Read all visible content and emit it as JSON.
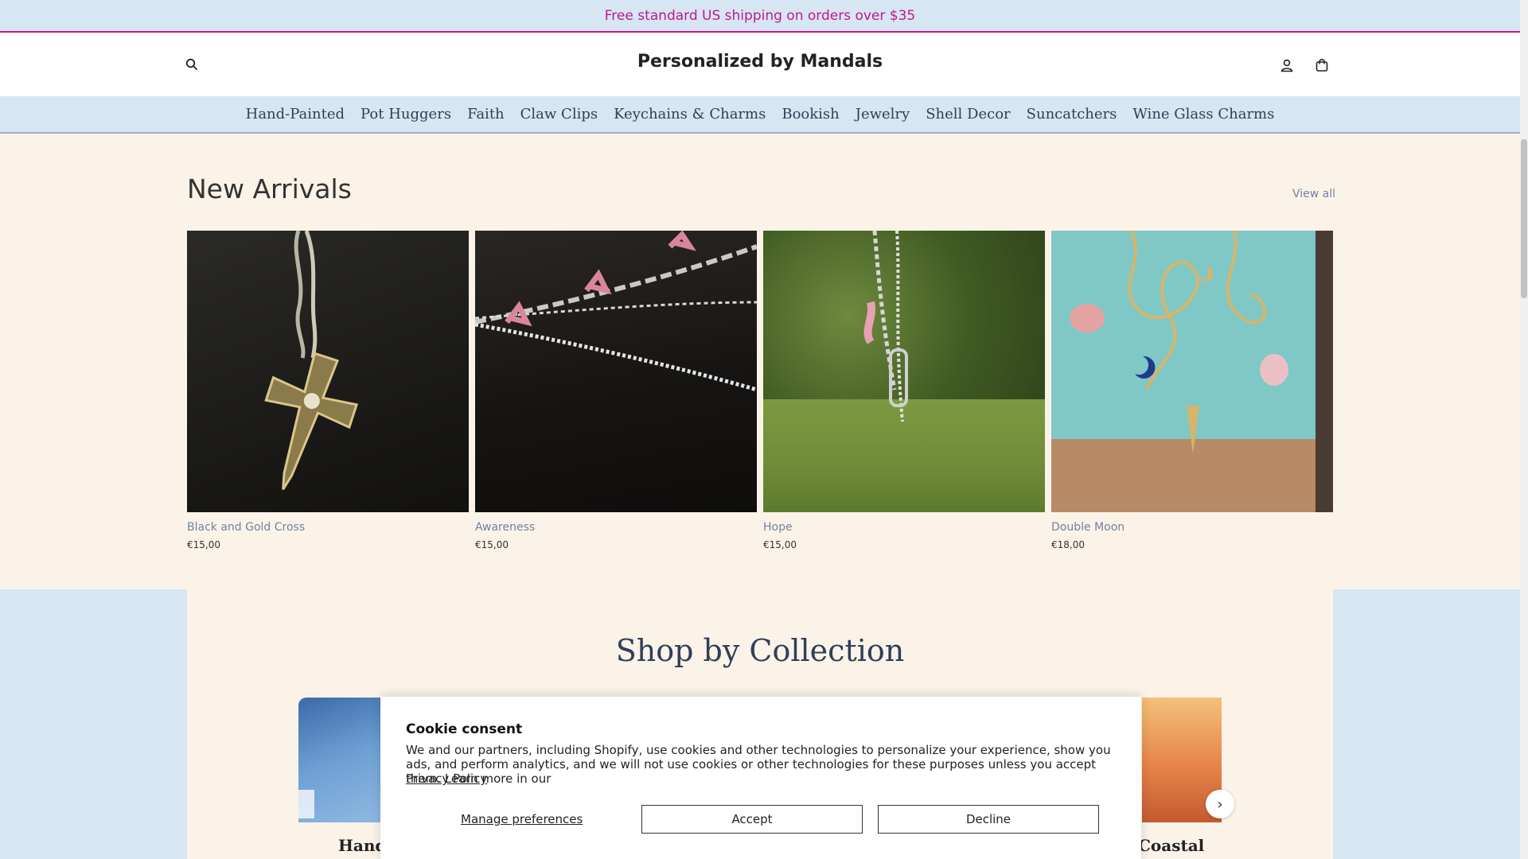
{
  "announcement": "Free standard US shipping on orders over $35",
  "header": {
    "brand": "Personalized by Mandals"
  },
  "nav": {
    "items": [
      "Hand-Painted",
      "Pot Huggers",
      "Faith",
      "Claw Clips",
      "Keychains & Charms",
      "Bookish",
      "Jewelry",
      "Shell Decor",
      "Suncatchers",
      "Wine Glass Charms"
    ]
  },
  "new_arrivals": {
    "heading": "New Arrivals",
    "view_all": "View all",
    "products": [
      {
        "title": "Black and Gold Cross",
        "price": "€15,00"
      },
      {
        "title": "Awareness",
        "price": "€15,00"
      },
      {
        "title": "Hope",
        "price": "€15,00"
      },
      {
        "title": "Double Moon",
        "price": "€18,00"
      }
    ]
  },
  "collections": {
    "heading": "Shop by Collection",
    "left_label": "Hand",
    "right_label": "Coastal",
    "next_arrow": "›"
  },
  "cookie": {
    "title": "Cookie consent",
    "text": "We and our partners, including Shopify, use cookies and other technologies to personalize your experience, show you ads, and perform analytics, and we will not use cookies or other technologies for these purposes unless you accept them. Learn more in our",
    "policy_link": "Privacy Policy",
    "manage": "Manage preferences",
    "accept": "Accept",
    "decline": "Decline"
  },
  "colors": {
    "announcement_text": "#c2188f",
    "nav_bg": "#d6e6f2",
    "page_bg": "#fbf3e8",
    "link": "#6f84a0"
  }
}
